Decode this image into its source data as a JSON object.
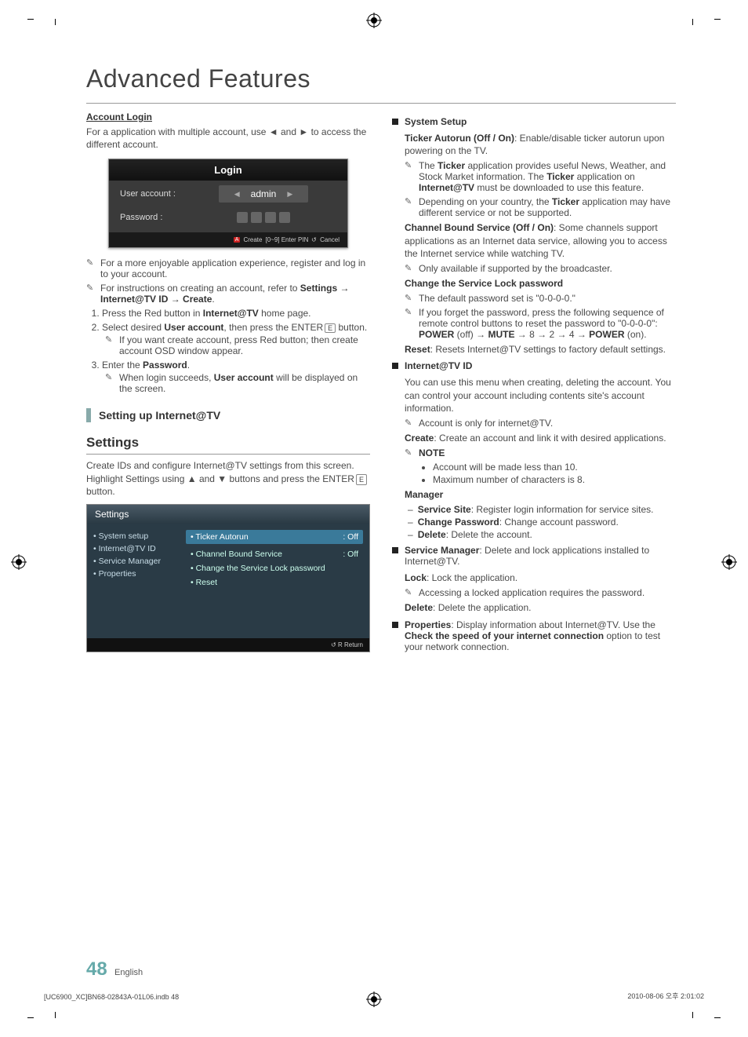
{
  "page_title": "Advanced Features",
  "left": {
    "account_login_h": "Account Login",
    "account_login_p": "For a application with multiple account, use ◄ and ► to access the different account.",
    "login_box": {
      "title": "Login",
      "user_label": "User account :",
      "user_value": "admin",
      "pwd_label": "Password :",
      "footer_create": "Create",
      "footer_enter": "[0~9] Enter PIN",
      "footer_cancel": "Cancel"
    },
    "note1": "For a more enjoyable application experience, register and log in to your account.",
    "note2_a": "For instructions on creating an account, refer to ",
    "note2_b": "Settings → Internet@TV ID → Create",
    "ol1_a": "Press the Red button in ",
    "ol1_b": "Internet@TV",
    "ol1_c": " home page.",
    "ol2_a": "Select desired ",
    "ol2_b": "User account",
    "ol2_c": ", then press the ENTER",
    "ol2_d": " button.",
    "ol2_note": "If you want create account, press Red button; then create account OSD window appear.",
    "ol3_a": "Enter the ",
    "ol3_b": "Password",
    "ol3_note_a": "When login succeeds, ",
    "ol3_note_b": "User account",
    "ol3_note_c": " will be displayed on the screen.",
    "setting_bar": "Setting up Internet@TV",
    "settings_h": "Settings",
    "settings_p_a": "Create IDs and configure Internet@TV settings from this screen. Highlight Settings using ▲ and ▼ buttons and press the ENTER",
    "settings_p_b": " button.",
    "settings_box": {
      "title": "Settings",
      "nav": [
        "• System setup",
        "• Internet@TV ID",
        "• Service Manager",
        "• Properties"
      ],
      "hl_label": "• Ticker Autorun",
      "hl_val": ": Off",
      "row2_label": "• Channel Bound Service",
      "row2_val": ": Off",
      "row3": "• Change the Service Lock password",
      "row4": "• Reset",
      "footer": "R Return"
    }
  },
  "right": {
    "system_setup_h": "System Setup",
    "ticker_a": "Ticker Autorun (Off / On)",
    "ticker_b": ": Enable/disable ticker autorun upon powering on the TV.",
    "ticker_n1_a": "The ",
    "ticker_n1_b": "Ticker",
    "ticker_n1_c": " application provides useful News, Weather, and Stock Market information. The ",
    "ticker_n1_d": "Ticker",
    "ticker_n1_e": " application on ",
    "ticker_n1_f": "Internet@TV",
    "ticker_n1_g": " must be downloaded to use this feature.",
    "ticker_n2_a": "Depending on your country, the ",
    "ticker_n2_b": "Ticker",
    "ticker_n2_c": " application may have different service or not be supported.",
    "cbs_a": "Channel Bound Service (Off / On)",
    "cbs_b": ": Some channels support applications as an Internet data service, allowing you to access the Internet service while watching TV.",
    "cbs_n": "Only available if supported by the broadcaster.",
    "chg_h": "Change the Service Lock password",
    "chg_n1": "The default password set is \"0-0-0-0.\"",
    "chg_n2_a": "If you forget the password, press the following sequence of remote control buttons to reset the password to \"0-0-0-0\": ",
    "chg_n2_b": "POWER",
    "chg_n2_c": " (off) → ",
    "chg_n2_d": "MUTE",
    "chg_n2_e": " → 8 → 2 → 4 → ",
    "chg_n2_f": "POWER",
    "chg_n2_g": " (on).",
    "reset_a": "Reset",
    "reset_b": ": Resets Internet@TV settings to factory default settings.",
    "internet_h": "Internet@TV ID",
    "internet_p": "You can use this menu when creating, deleting the account. You can control your account including contents site's account information.",
    "internet_n": "Account is only for internet@TV.",
    "create_a": "Create",
    "create_b": ": Create an account and link it with desired applications.",
    "note_h": "NOTE",
    "note_li1": "Account will be made less than 10.",
    "note_li2": "Maximum number of characters is 8.",
    "manager_h": "Manager",
    "mgr_d1_a": "Service Site",
    "mgr_d1_b": ": Register login information for service sites.",
    "mgr_d2_a": "Change Password",
    "mgr_d2_b": ": Change account password.",
    "mgr_d3_a": "Delete",
    "mgr_d3_b": ": Delete the account.",
    "svcmgr_a": "Service Manager",
    "svcmgr_b": ": Delete and lock applications installed to Internet@TV.",
    "lock_a": "Lock",
    "lock_b": ": Lock the application.",
    "lock_n": "Accessing a locked application requires the password.",
    "del_a": "Delete",
    "del_b": ": Delete the application.",
    "prop_a": "Properties",
    "prop_b": ": Display information about Internet@TV. Use the ",
    "prop_c": "Check the speed of your internet connection",
    "prop_d": " option to test your network connection."
  },
  "footer": {
    "page": "48",
    "lang": "English",
    "left": "[UC6900_XC]BN68-02843A-01L06.indb   48",
    "right": "2010-08-06   오후 2:01:02"
  }
}
